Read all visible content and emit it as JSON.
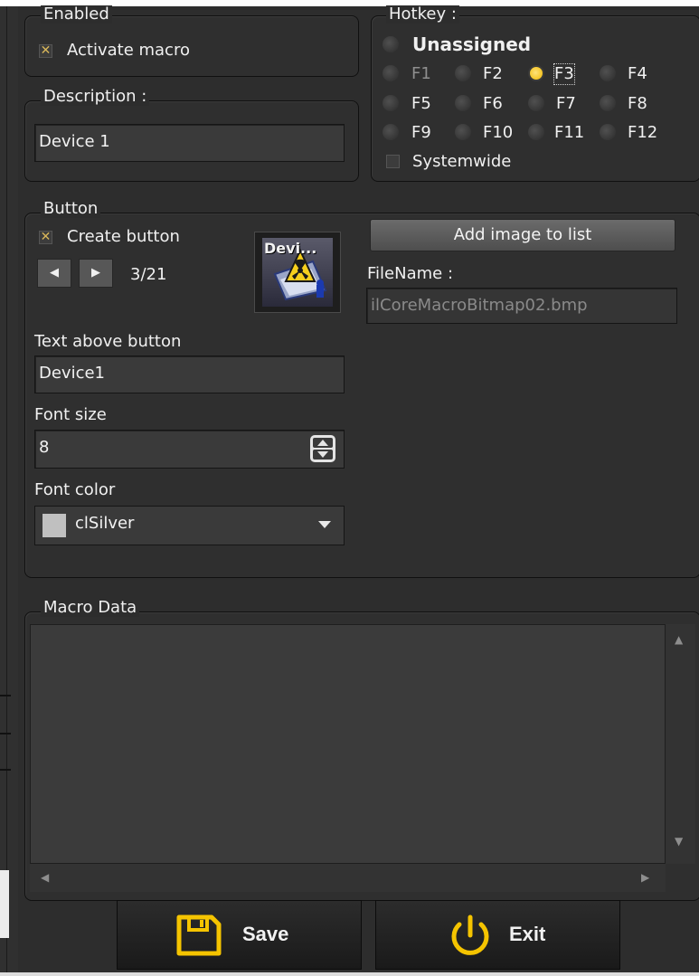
{
  "enabled_group": {
    "legend": "Enabled",
    "activate_macro_label": "Activate macro",
    "activate_macro_checked": true
  },
  "description_group": {
    "legend": "Description :",
    "value": "Device 1"
  },
  "hotkey_group": {
    "legend": "Hotkey :",
    "unassigned_label": "Unassigned",
    "keys": [
      "F1",
      "F2",
      "F3",
      "F4",
      "F5",
      "F6",
      "F7",
      "F8",
      "F9",
      "F10",
      "F11",
      "F12"
    ],
    "selected": "F3",
    "systemwide_label": "Systemwide",
    "systemwide_checked": false
  },
  "button_group": {
    "legend": "Button",
    "create_button_label": "Create button",
    "create_button_checked": true,
    "image_counter": "3/21",
    "preview_caption": "Devi...",
    "add_image_label": "Add image to list",
    "filename_label": "FileName :",
    "filename_value": "ilCoreMacroBitmap02.bmp",
    "text_above_label": "Text above button",
    "text_above_value": "Device1",
    "font_size_label": "Font size",
    "font_size_value": "8",
    "font_color_label": "Font color",
    "font_color_value": "clSilver",
    "font_color_swatch": "#c0c0c0"
  },
  "macro_data_group": {
    "legend": "Macro Data"
  },
  "footer": {
    "save_label": "Save",
    "exit_label": "Exit",
    "accent_color": "#f5c400"
  }
}
